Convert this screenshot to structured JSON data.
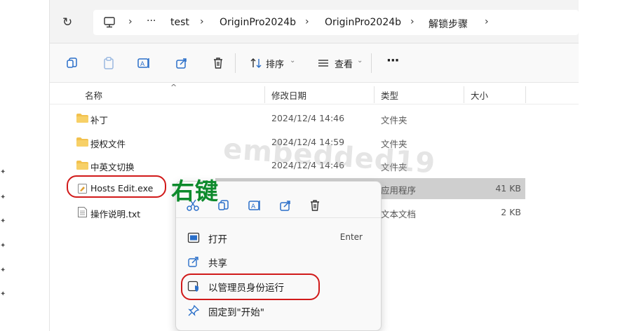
{
  "address": {
    "more": "···",
    "crumbs": [
      "test",
      "OriginPro2024b",
      "OriginPro2024b",
      "解锁步骤"
    ],
    "separator": "›"
  },
  "toolbar": {
    "sort_label": "排序",
    "view_label": "查看",
    "more_label": "···"
  },
  "columns": {
    "name": "名称",
    "modified": "修改日期",
    "type": "类型",
    "size": "大小"
  },
  "files": [
    {
      "name": "补丁",
      "modified": "2024/12/4 14:46",
      "type": "文件夹",
      "size": "",
      "icon": "folder-icon"
    },
    {
      "name": "授权文件",
      "modified": "2024/12/4 14:59",
      "type": "文件夹",
      "size": "",
      "icon": "folder-icon"
    },
    {
      "name": "中英文切换",
      "modified": "2024/12/4 14:46",
      "type": "文件夹",
      "size": "",
      "icon": "folder-icon"
    },
    {
      "name": "Hosts Edit.exe",
      "modified": "",
      "type": "应用程序",
      "size": "41 KB",
      "icon": "exe-icon"
    },
    {
      "name": "操作说明.txt",
      "modified": "",
      "type": "文本文档",
      "size": "2 KB",
      "icon": "text-file-icon"
    }
  ],
  "watermark": "embedded19",
  "annotation": "右键",
  "context_menu": {
    "items": [
      {
        "label": "打开",
        "shortcut": "Enter",
        "icon": "open-icon"
      },
      {
        "label": "共享",
        "shortcut": "",
        "icon": "share-icon"
      },
      {
        "label": "以管理员身份运行",
        "shortcut": "",
        "icon": "admin-shield-icon"
      },
      {
        "label": "固定到\"开始\"",
        "shortcut": "",
        "icon": "pin-icon"
      }
    ]
  },
  "colors": {
    "annotation_red": "#d11a1a",
    "annotation_green": "#0d8a2c",
    "folder_yellow": "#f2c14e",
    "icon_blue": "#2a6fc9"
  }
}
